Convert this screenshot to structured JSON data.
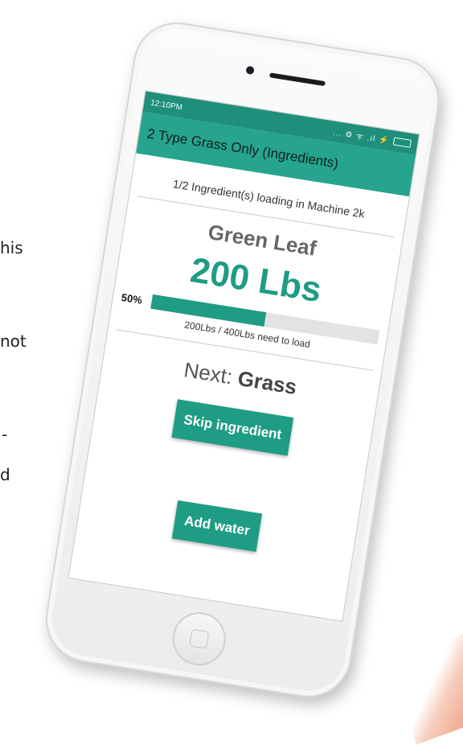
{
  "background_fragments": [
    "his",
    "not",
    "-",
    "d"
  ],
  "status_bar": {
    "time": "12:10PM",
    "icons": "... ⚙ ᯤ .ıl ⚡"
  },
  "app_bar": {
    "title": "2 Type Grass Only (Ingredients)"
  },
  "loading": {
    "text": "1/2 Ingredient(s) loading in Machine 2k"
  },
  "ingredient": {
    "name": "Green Leaf",
    "amount": "200 Lbs"
  },
  "progress": {
    "percent_label": "50%",
    "fraction": 0.5,
    "note": "200Lbs / 400Lbs  need to load"
  },
  "next": {
    "label": "Next:",
    "value": "Grass"
  },
  "buttons": {
    "skip": "Skip ingredient",
    "add_water": "Add water"
  },
  "colors": {
    "primary": "#26a48d",
    "primary_dark": "#1f8f7b",
    "accent": "#1f9c84"
  }
}
